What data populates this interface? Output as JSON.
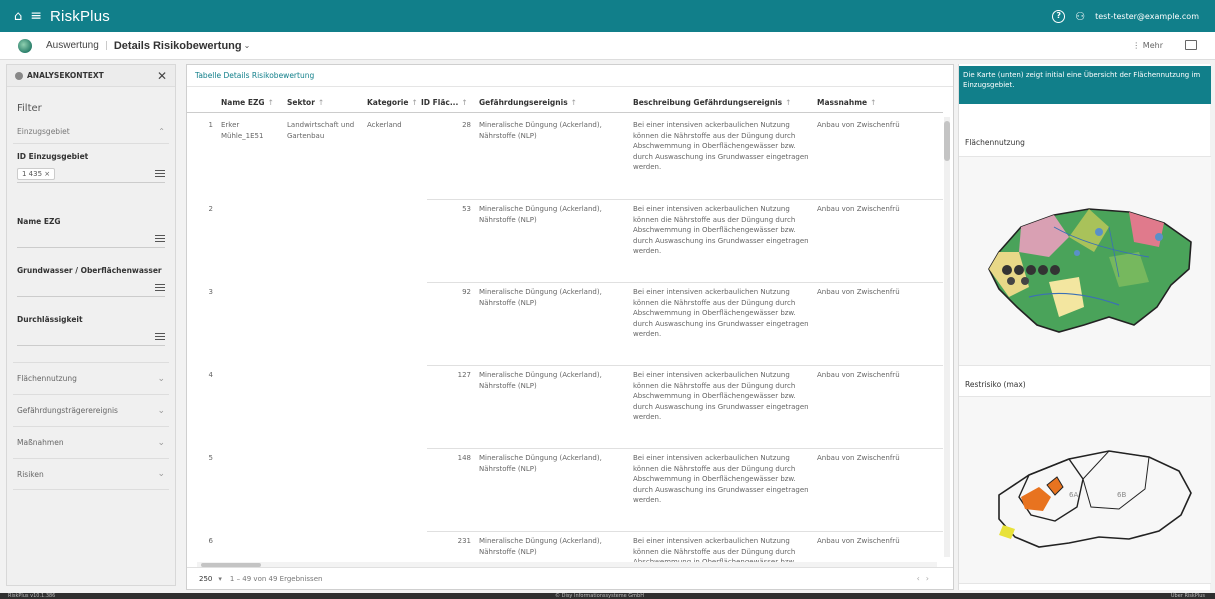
{
  "app": {
    "name": "RiskPlus",
    "user_email": "test-tester@example.com"
  },
  "breadcrumb": {
    "parent": "Auswertung",
    "current": "Details Risikobewertung"
  },
  "toolbar": {
    "more_label": "⋮ Mehr"
  },
  "sidebar": {
    "header": "ANALYSEKONTEXT",
    "filter_title": "Filter",
    "einzugsgebiet_label": "Einzugsgebiet",
    "fields": [
      {
        "label": "ID Einzugsgebiet",
        "chip": "1 435 ×"
      },
      {
        "label": "Name EZG"
      },
      {
        "label": "Grundwasser / Oberflächenwasser"
      },
      {
        "label": "Durchlässigkeit"
      }
    ],
    "accordions": [
      "Flächennutzung",
      "Gefährdungsträgerereignis",
      "Maßnahmen",
      "Risiken"
    ]
  },
  "table": {
    "title": "Tabelle Details Risikobewertung",
    "columns": [
      "",
      "Name EZG",
      "Sektor",
      "Kategorie",
      "ID Fläc...",
      "Gefährdungsereignis",
      "Beschreibung Gefährdungsereignis",
      "Massnahme"
    ],
    "first_row": {
      "index": "1",
      "name_ezg": "Erker Mühle_1E51",
      "sektor": "Landwirtschaft und Gartenbau",
      "kategorie": "Ackerland"
    },
    "rows": [
      {
        "index": "1",
        "id": "28"
      },
      {
        "index": "2",
        "id": "53"
      },
      {
        "index": "3",
        "id": "92"
      },
      {
        "index": "4",
        "id": "127"
      },
      {
        "index": "5",
        "id": "148"
      },
      {
        "index": "6",
        "id": "231"
      }
    ],
    "ereignis": "Mineralische Düngung (Ackerland), Nährstoffe (NLP)",
    "beschreibung": "Bei einer intensiven ackerbaulichen Nutzung können die Nährstoffe aus der Düngung durch Abschwemmung in Oberflächengewässer bzw. durch Auswaschung ins Grundwasser eingetragen werden.",
    "massnahme": "Anbau von Zwischenfrü",
    "page_size": "250",
    "result_count": "1 – 49 von 49 Ergebnissen"
  },
  "right": {
    "info_text": "Die Karte (unten) zeigt initial eine Übersicht der Flächennutzung im Einzugsgebiet.",
    "map1_title": "Flächennutzung",
    "map2_title": "Restrisiko (max)",
    "map2_labels": [
      "6A",
      "6B"
    ]
  },
  "footer": {
    "version": "RiskPlus v10.1.386",
    "copyright": "© Disy Informationssysteme GmbH",
    "about": "Über RiskPlus"
  },
  "colors": {
    "accent": "#117f8a"
  }
}
